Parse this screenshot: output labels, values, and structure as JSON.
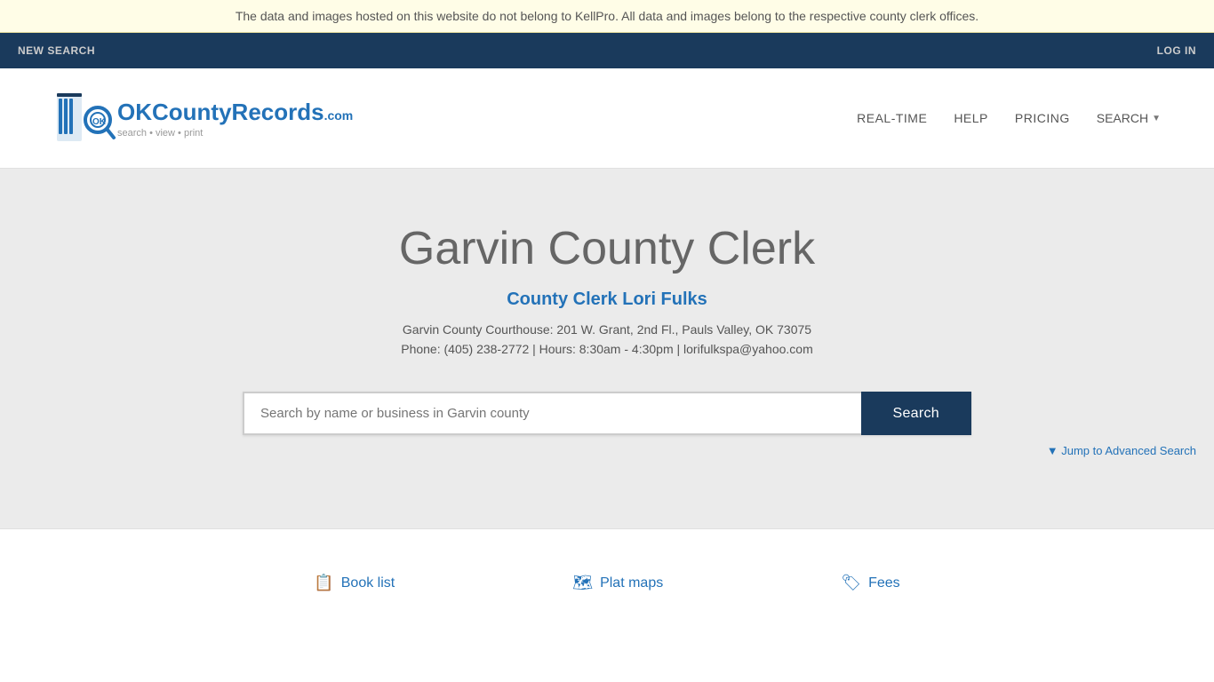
{
  "banner": {
    "text": "The data and images hosted on this website do not belong to KellPro. All data and images belong to the respective county clerk offices."
  },
  "topnav": {
    "new_search": "NEW SEARCH",
    "log_in": "LOG IN"
  },
  "header": {
    "logo": {
      "brand": "OKCountyRecords",
      "domain": ".com",
      "tagline": "search • view • print"
    },
    "nav": {
      "realtime": "REAL-TIME",
      "help": "HELP",
      "pricing": "PRICING",
      "search": "SEARCH"
    }
  },
  "hero": {
    "title": "Garvin County Clerk",
    "subtitle": "County Clerk Lori Fulks",
    "address": "Garvin County Courthouse: 201 W. Grant, 2nd Fl., Pauls Valley, OK 73075",
    "contact": "Phone: (405) 238-2772 | Hours: 8:30am - 4:30pm | lorifulkspa@yahoo.com",
    "search_placeholder": "Search by name or business in Garvin county",
    "search_button": "Search",
    "advanced_search_label": "▼ Jump to Advanced Search"
  },
  "footer": {
    "links": [
      {
        "label": "Book list",
        "icon": "📋"
      },
      {
        "label": "Plat maps",
        "icon": "🗺"
      },
      {
        "label": "Fees",
        "icon": "🏷"
      }
    ]
  }
}
